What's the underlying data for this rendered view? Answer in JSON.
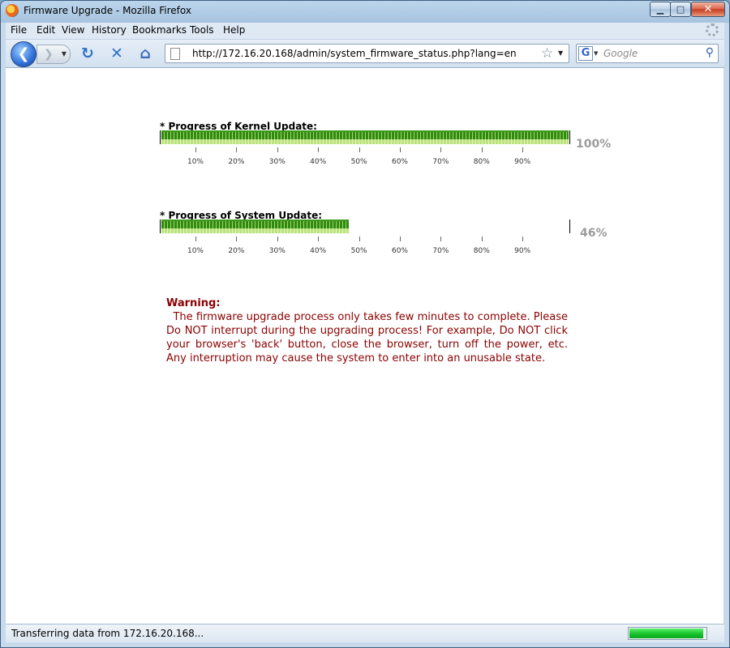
{
  "window": {
    "title": "Firmware Upgrade - Mozilla Firefox"
  },
  "menu": [
    "File",
    "Edit",
    "View",
    "History",
    "Bookmarks",
    "Tools",
    "Help"
  ],
  "toolbar": {
    "url": "http://172.16.20.168/admin/system_firmware_status.php?lang=en",
    "search_engine_letter": "G",
    "search_placeholder": "Google"
  },
  "kernel": {
    "title": "* Progress of Kernel Update:",
    "percent": 100,
    "percent_label": "100%"
  },
  "system": {
    "title": "* Progress of System Update:",
    "percent": 46,
    "percent_label": "46%"
  },
  "ticks": [
    "10%",
    "20%",
    "30%",
    "40%",
    "50%",
    "60%",
    "70%",
    "80%",
    "90%"
  ],
  "warning": {
    "title": "Warning:",
    "body": "The firmware upgrade process only takes few minutes to complete. Please Do NOT interrupt during the upgrading process! For example, Do NOT click your browser's 'back' button, close the browser, turn off the power, etc. Any interruption may cause the system to enter into an unusable state."
  },
  "status": {
    "text": "Transferring data from 172.16.20.168...",
    "load_progress": 0.97
  },
  "colors": {
    "bar_dark": "#2e8a12",
    "bar_light": "#a7d56a",
    "warning": "#8b0000",
    "percent": "#9b9b9b"
  }
}
